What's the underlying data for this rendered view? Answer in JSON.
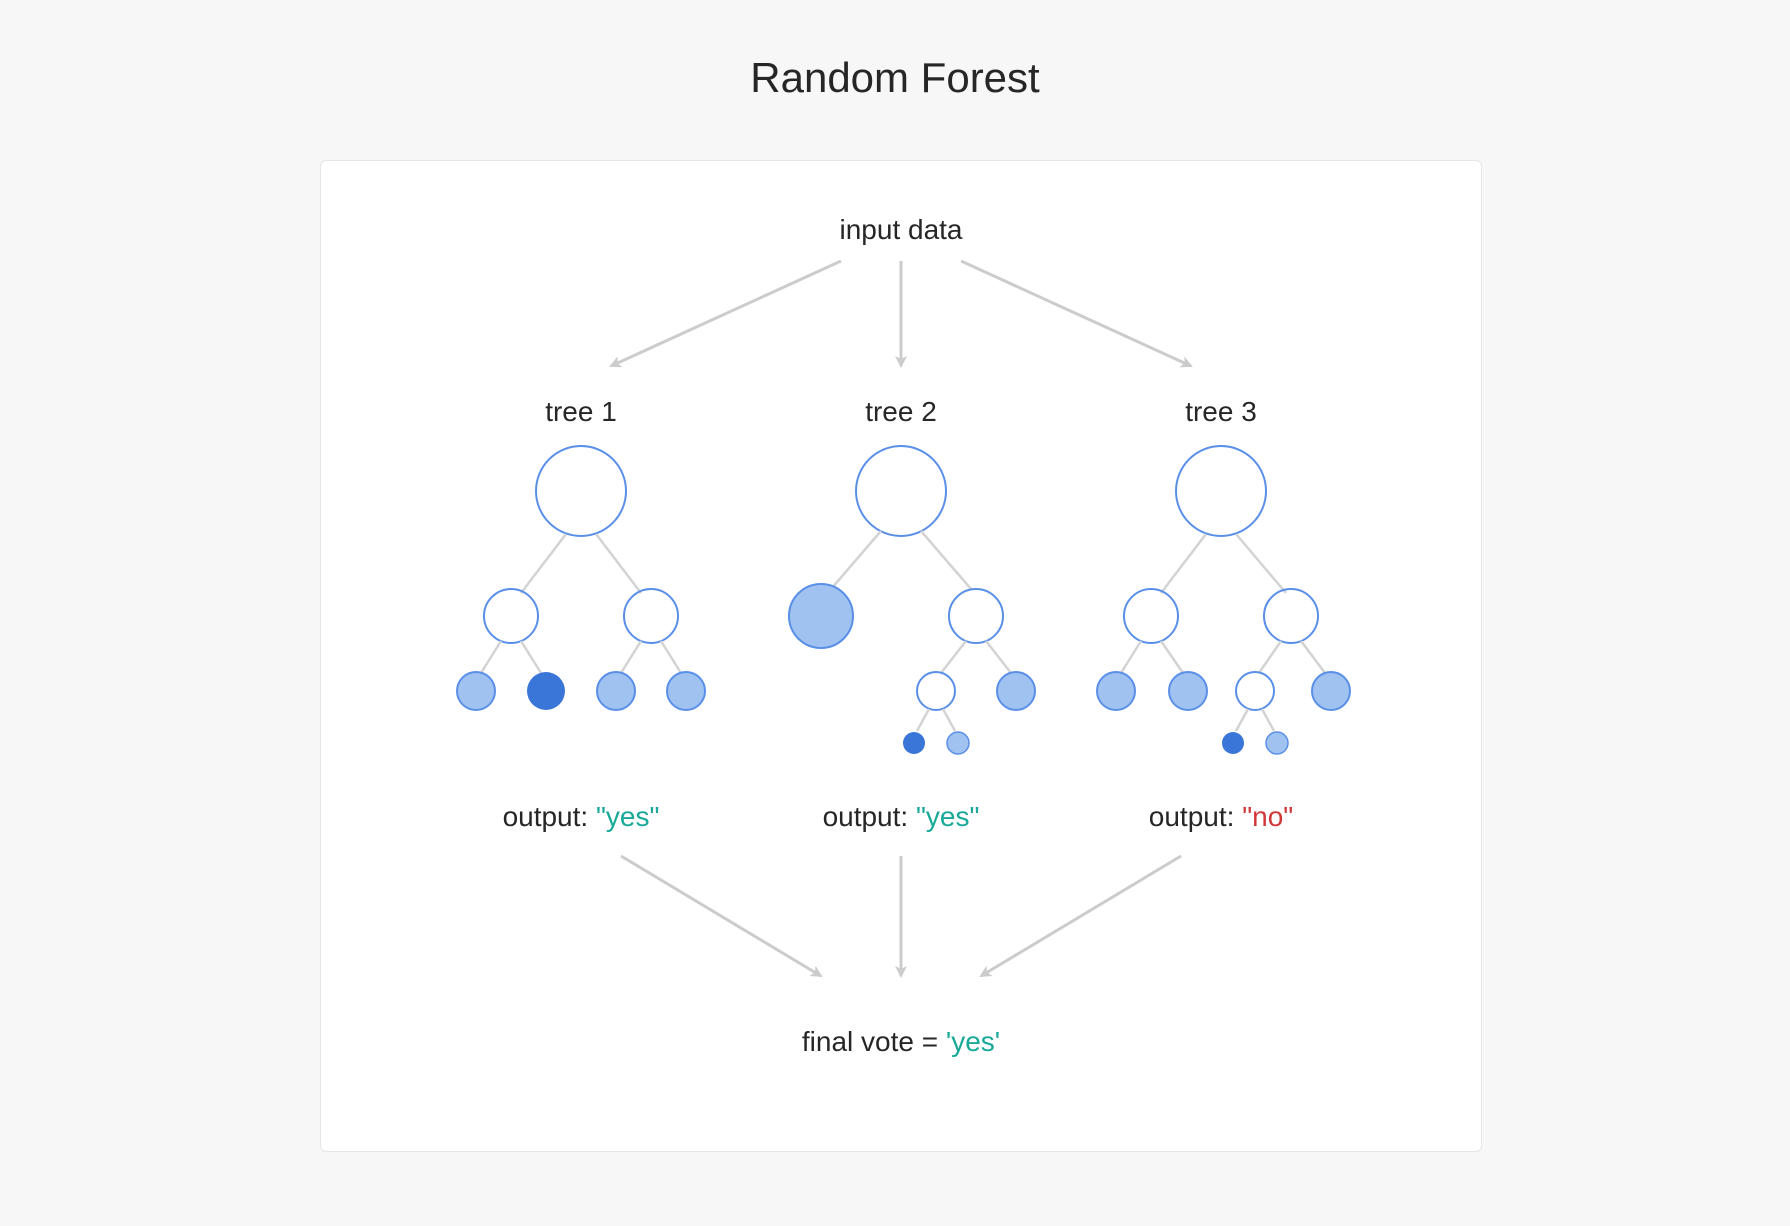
{
  "title": "Random Forest",
  "input_label": "input data",
  "final_vote": {
    "label": "final vote = ",
    "value": "'yes'"
  },
  "trees": [
    {
      "label": "tree 1",
      "output_prefix": "output: ",
      "output_value": "\"yes\"",
      "output_class": "green"
    },
    {
      "label": "tree 2",
      "output_prefix": "output: ",
      "output_value": "\"yes\"",
      "output_class": "green"
    },
    {
      "label": "tree 3",
      "output_prefix": "output: ",
      "output_value": "\"no\"",
      "output_class": "red"
    }
  ],
  "colors": {
    "node_stroke": "#5a8fe8",
    "fill_light": "#9fc2f1",
    "fill_dark": "#3a76d8",
    "arrow": "#cccccc",
    "branch": "#d3d3d3",
    "green": "#18a999",
    "red": "#d0383a"
  }
}
